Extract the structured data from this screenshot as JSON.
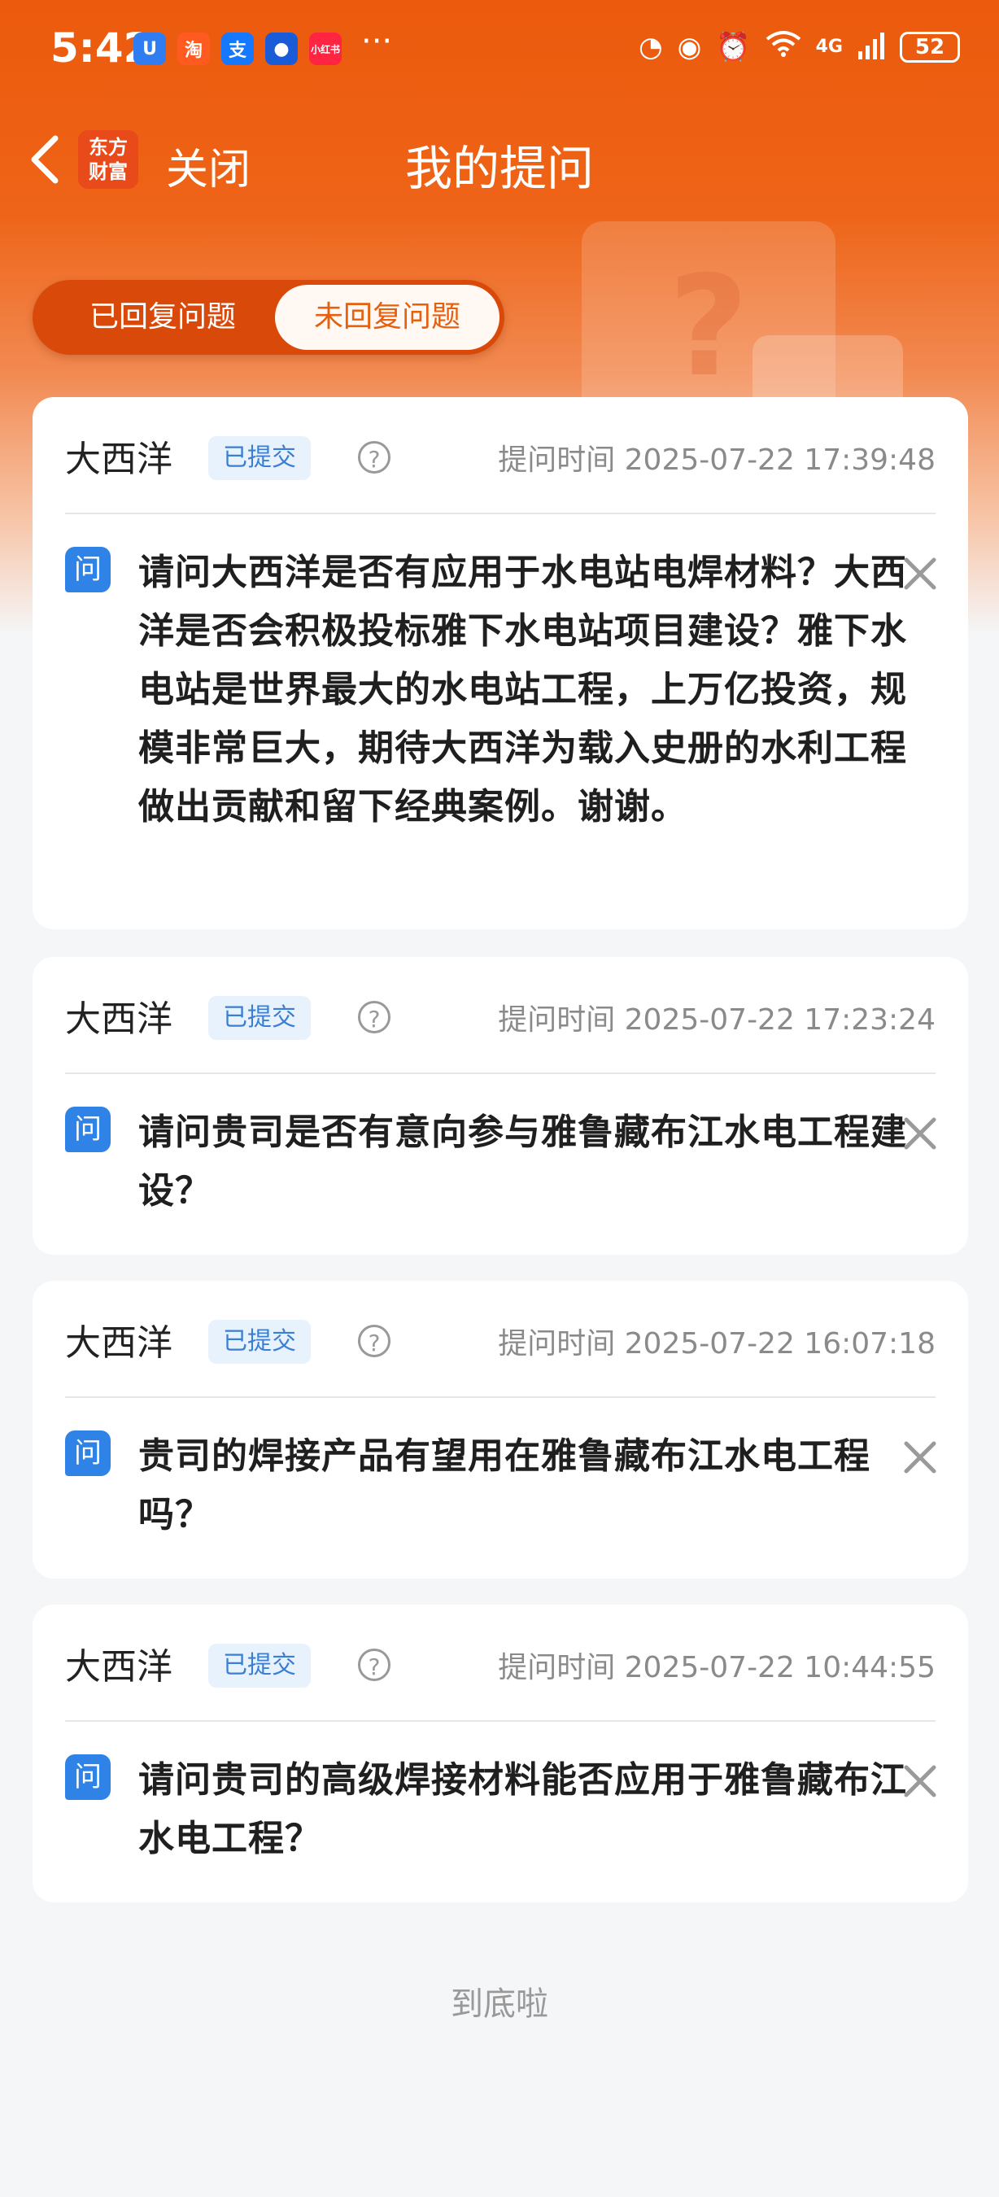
{
  "status_bar": {
    "time": "5:42",
    "network": "4G",
    "battery": "52",
    "more": "···",
    "apps": [
      {
        "name": "app-icon-blue",
        "color": "#2f7df0",
        "glyph": "U"
      },
      {
        "name": "taobao-icon",
        "color": "#ff5a1f",
        "glyph": "淘"
      },
      {
        "name": "alipay-icon",
        "color": "#1677ff",
        "glyph": "支"
      },
      {
        "name": "app-icon-dark",
        "color": "#1a5bd8",
        "glyph": "●"
      },
      {
        "name": "xiaohongshu-icon",
        "color": "#ff2442",
        "glyph": "小红书"
      }
    ]
  },
  "nav": {
    "logo_line1": "东方",
    "logo_line2": "财富",
    "close_label": "关闭",
    "title": "我的提问"
  },
  "tabs": {
    "replied": "已回复问题",
    "unreplied": "未回复问题",
    "active": "unreplied"
  },
  "questions": [
    {
      "asker": "大西洋",
      "status": "已提交",
      "time": "提问时间 2025-07-22 17:39:48",
      "icon_label": "问",
      "text": "请问大西洋是否有应用于水电站电焊材料？大西洋是否会积极投标雅下水电站项目建设？雅下水电站是世界最大的水电站工程，上万亿投资，规模非常巨大，期待大西洋为载入史册的水利工程做出贡献和留下经典案例。谢谢。"
    },
    {
      "asker": "大西洋",
      "status": "已提交",
      "time": "提问时间 2025-07-22 17:23:24",
      "icon_label": "问",
      "text": "请问贵司是否有意向参与雅鲁藏布江水电工程建设？"
    },
    {
      "asker": "大西洋",
      "status": "已提交",
      "time": "提问时间 2025-07-22 16:07:18",
      "icon_label": "问",
      "text": "贵司的焊接产品有望用在雅鲁藏布江水电工程吗？"
    },
    {
      "asker": "大西洋",
      "status": "已提交",
      "time": "提问时间 2025-07-22 10:44:55",
      "icon_label": "问",
      "text": "请问贵司的高级焊接材料能否应用于雅鲁藏布江水电工程？"
    }
  ],
  "footer": "到底啦",
  "colors": {
    "brand_orange": "#ec5a0d",
    "badge_blue": "#3b7fd3",
    "question_icon_blue": "#2f83e6"
  }
}
